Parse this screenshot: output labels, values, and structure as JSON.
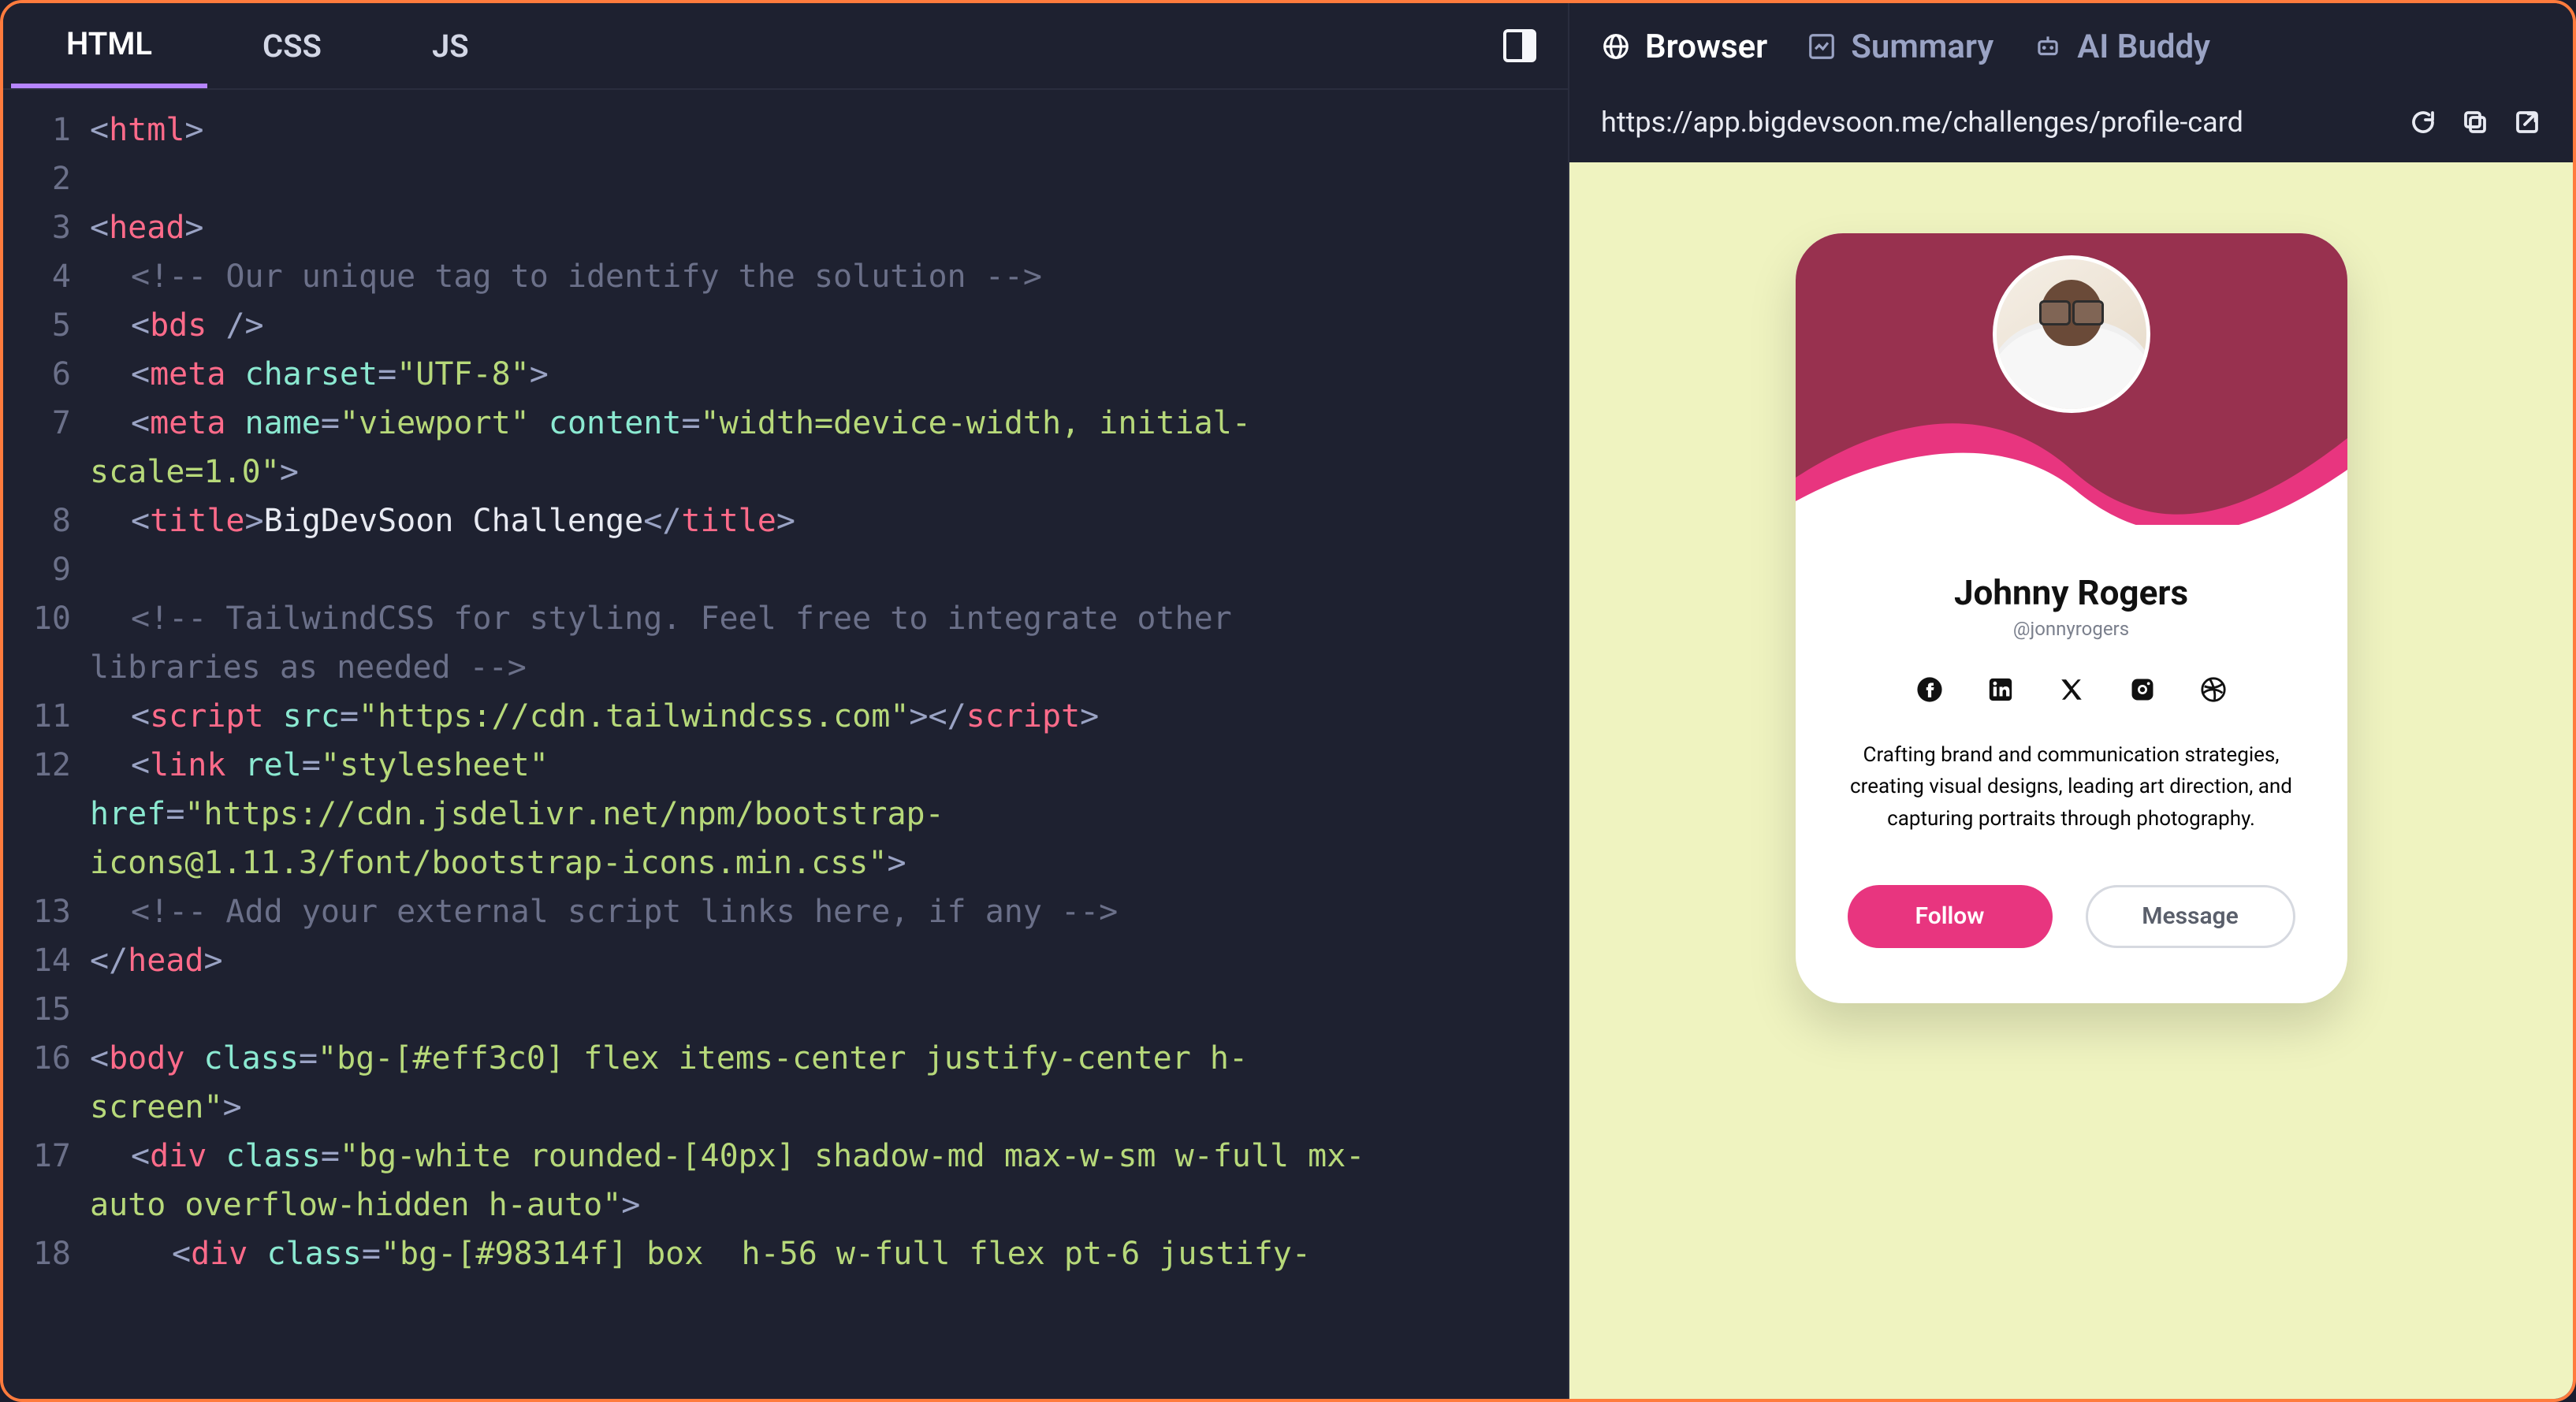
{
  "editor": {
    "tabs": [
      "HTML",
      "CSS",
      "JS"
    ],
    "active_tab": 0,
    "code_lines": [
      {
        "n": 1,
        "wrap": false,
        "segs": [
          [
            "punc",
            "<"
          ],
          [
            "tag",
            "html"
          ],
          [
            "punc",
            ">"
          ]
        ]
      },
      {
        "n": 2,
        "wrap": false,
        "segs": []
      },
      {
        "n": 3,
        "wrap": false,
        "segs": [
          [
            "punc",
            "<"
          ],
          [
            "tag",
            "head"
          ],
          [
            "punc",
            ">"
          ]
        ]
      },
      {
        "n": 4,
        "wrap": false,
        "segs": [
          [
            "indent",
            1
          ],
          [
            "cmt",
            "<!-- Our unique tag to identify the solution -->"
          ]
        ]
      },
      {
        "n": 5,
        "wrap": false,
        "segs": [
          [
            "indent",
            1
          ],
          [
            "punc",
            "<"
          ],
          [
            "tag",
            "bds"
          ],
          [
            "text",
            " "
          ],
          [
            "punc",
            "/>"
          ]
        ]
      },
      {
        "n": 6,
        "wrap": false,
        "segs": [
          [
            "indent",
            1
          ],
          [
            "punc",
            "<"
          ],
          [
            "tag",
            "meta"
          ],
          [
            "text",
            " "
          ],
          [
            "attr",
            "charset"
          ],
          [
            "punc",
            "="
          ],
          [
            "val",
            "\"UTF-8\""
          ],
          [
            "punc",
            ">"
          ]
        ]
      },
      {
        "n": 7,
        "wrap": false,
        "segs": [
          [
            "indent",
            1
          ],
          [
            "punc",
            "<"
          ],
          [
            "tag",
            "meta"
          ],
          [
            "text",
            " "
          ],
          [
            "attr",
            "name"
          ],
          [
            "punc",
            "="
          ],
          [
            "val",
            "\"viewport\""
          ],
          [
            "text",
            " "
          ],
          [
            "attr",
            "content"
          ],
          [
            "punc",
            "="
          ],
          [
            "val",
            "\"width=device-width, initial-"
          ]
        ]
      },
      {
        "n": null,
        "wrap": true,
        "segs": [
          [
            "val",
            "scale=1.0\""
          ],
          [
            "punc",
            ">"
          ]
        ]
      },
      {
        "n": 8,
        "wrap": false,
        "segs": [
          [
            "indent",
            1
          ],
          [
            "punc",
            "<"
          ],
          [
            "tag",
            "title"
          ],
          [
            "punc",
            ">"
          ],
          [
            "text",
            "BigDevSoon Challenge"
          ],
          [
            "punc",
            "</"
          ],
          [
            "tag",
            "title"
          ],
          [
            "punc",
            ">"
          ]
        ]
      },
      {
        "n": 9,
        "wrap": false,
        "segs": []
      },
      {
        "n": 10,
        "wrap": false,
        "segs": [
          [
            "indent",
            1
          ],
          [
            "cmt",
            "<!-- TailwindCSS for styling. Feel free to integrate other"
          ]
        ]
      },
      {
        "n": null,
        "wrap": true,
        "segs": [
          [
            "cmt",
            "libraries as needed -->"
          ]
        ]
      },
      {
        "n": 11,
        "wrap": false,
        "segs": [
          [
            "indent",
            1
          ],
          [
            "punc",
            "<"
          ],
          [
            "tag",
            "script"
          ],
          [
            "text",
            " "
          ],
          [
            "attr",
            "src"
          ],
          [
            "punc",
            "="
          ],
          [
            "val",
            "\"https://cdn.tailwindcss.com\""
          ],
          [
            "punc",
            "></"
          ],
          [
            "tag",
            "script"
          ],
          [
            "punc",
            ">"
          ]
        ]
      },
      {
        "n": 12,
        "wrap": false,
        "segs": [
          [
            "indent",
            1
          ],
          [
            "punc",
            "<"
          ],
          [
            "tag",
            "link"
          ],
          [
            "text",
            " "
          ],
          [
            "attr",
            "rel"
          ],
          [
            "punc",
            "="
          ],
          [
            "val",
            "\"stylesheet\""
          ]
        ]
      },
      {
        "n": null,
        "wrap": true,
        "segs": [
          [
            "attr",
            "href"
          ],
          [
            "punc",
            "="
          ],
          [
            "val",
            "\"https://cdn.jsdelivr.net/npm/bootstrap-"
          ]
        ]
      },
      {
        "n": null,
        "wrap": true,
        "segs": [
          [
            "val",
            "icons@1.11.3/font/bootstrap-icons.min.css\""
          ],
          [
            "punc",
            ">"
          ]
        ]
      },
      {
        "n": 13,
        "wrap": false,
        "segs": [
          [
            "indent",
            1
          ],
          [
            "cmt",
            "<!-- Add your external script links here, if any -->"
          ]
        ]
      },
      {
        "n": 14,
        "wrap": false,
        "segs": [
          [
            "punc",
            "</"
          ],
          [
            "tag",
            "head"
          ],
          [
            "punc",
            ">"
          ]
        ]
      },
      {
        "n": 15,
        "wrap": false,
        "segs": []
      },
      {
        "n": 16,
        "wrap": false,
        "segs": [
          [
            "punc",
            "<"
          ],
          [
            "tag",
            "body"
          ],
          [
            "text",
            " "
          ],
          [
            "attr",
            "class"
          ],
          [
            "punc",
            "="
          ],
          [
            "val",
            "\"bg-[#eff3c0] flex items-center justify-center h-"
          ]
        ]
      },
      {
        "n": null,
        "wrap": true,
        "segs": [
          [
            "val",
            "screen\""
          ],
          [
            "punc",
            ">"
          ]
        ]
      },
      {
        "n": 17,
        "wrap": false,
        "segs": [
          [
            "indent",
            1
          ],
          [
            "punc",
            "<"
          ],
          [
            "tag",
            "div"
          ],
          [
            "text",
            " "
          ],
          [
            "attr",
            "class"
          ],
          [
            "punc",
            "="
          ],
          [
            "val",
            "\"bg-white rounded-[40px] shadow-md max-w-sm w-full mx-"
          ]
        ]
      },
      {
        "n": null,
        "wrap": true,
        "segs": [
          [
            "val",
            "auto overflow-hidden h-auto\""
          ],
          [
            "punc",
            ">"
          ]
        ]
      },
      {
        "n": 18,
        "wrap": false,
        "segs": [
          [
            "indent",
            2
          ],
          [
            "punc",
            "<"
          ],
          [
            "tag",
            "div"
          ],
          [
            "text",
            " "
          ],
          [
            "attr",
            "class"
          ],
          [
            "punc",
            "="
          ],
          [
            "val",
            "\"bg-[#98314f] box  h-56 w-full flex pt-6 justify-"
          ]
        ]
      }
    ]
  },
  "preview": {
    "tabs": [
      {
        "id": "browser",
        "label": "Browser"
      },
      {
        "id": "summary",
        "label": "Summary"
      },
      {
        "id": "aibuddy",
        "label": "AI Buddy"
      }
    ],
    "active_tab": 0,
    "url": "https://app.bigdevsoon.me/challenges/profile-card"
  },
  "profile": {
    "name": "Johnny Rogers",
    "handle": "@jonnyrogers",
    "bio": "Crafting brand and communication strategies, creating visual designs, leading art direction, and capturing portraits through photography.",
    "socials": [
      "facebook",
      "linkedin",
      "x",
      "instagram",
      "dribbble"
    ],
    "follow_label": "Follow",
    "message_label": "Message"
  }
}
